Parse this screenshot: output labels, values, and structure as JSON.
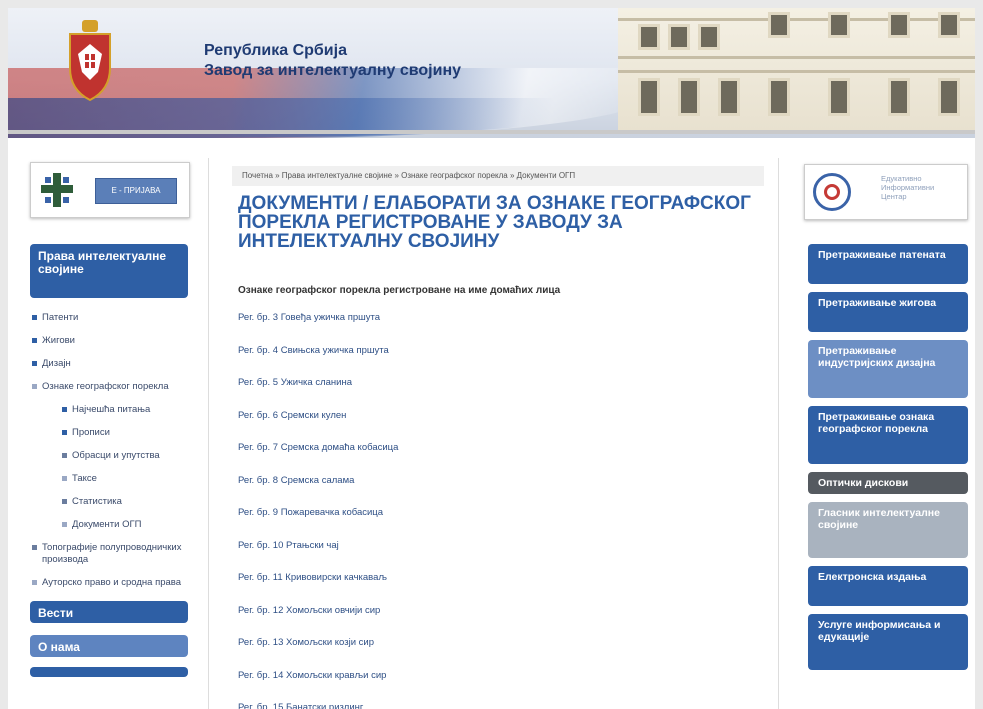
{
  "header": {
    "line1": "Република Србија",
    "line2": "Завод за интелектуалну својину"
  },
  "eprijava": {
    "button_label": "Е - ПРИЈАВА"
  },
  "left_nav": {
    "section_title": "Права интелектуалне својине",
    "items": [
      {
        "label": "Патенти",
        "level": 1
      },
      {
        "label": "Жигови",
        "level": 1
      },
      {
        "label": "Дизајн",
        "level": 1
      },
      {
        "label": "Ознаке географског порекла",
        "level": 1
      },
      {
        "label": "Најчешћа питања",
        "level": 2
      },
      {
        "label": "Прописи",
        "level": 2
      },
      {
        "label": "Обрасци и упутства",
        "level": 2
      },
      {
        "label": "Таксе",
        "level": 2
      },
      {
        "label": "Статистика",
        "level": 2
      },
      {
        "label": "Документи ОГП",
        "level": 2
      },
      {
        "label": "Топографије полупроводничких производа",
        "level": 1
      },
      {
        "label": "Ауторско право и сродна права",
        "level": 1
      }
    ],
    "bottom_buttons": [
      "Вести",
      "О нама"
    ]
  },
  "breadcrumb": "Почетна » Права интелектуалне својине » Ознаке географског порекла » Документи ОГП",
  "main": {
    "title": "ДОКУМЕНТИ / ЕЛАБОРАТИ ЗА ОЗНАКЕ ГЕОГРАФСКОГ ПОРЕКЛА РЕГИСТРОВАНЕ У ЗАВОДУ ЗА ИНТЕЛЕКТУАЛНУ СВОЈИНУ",
    "subtitle": "Ознаке географског порекла регистроване на име домаћих лица",
    "registrations": [
      "Рег. бр. 3 Говеђа ужичка пршута",
      "Рег. бр. 4 Свињска ужичка пршута",
      "Рег. бр. 5 Ужичка сланина",
      "Рег. бр. 6 Сремски кулен",
      "Рег. бр. 7 Сремска домаћа кобасица",
      "Рег. бр. 8 Сремска салама",
      "Рег. бр. 9 Пожаревачка кобасица",
      "Рег. бр. 10 Ртањски чај",
      "Рег. бр. 11 Кривовирски качкаваљ",
      "Рег. бр. 12 Хомољски овчији сир",
      "Рег. бр. 13 Хомољски козји сир",
      "Рег. бр. 14 Хомољски крављи сир",
      "Рег. бр. 15 Банатски ризлинг"
    ]
  },
  "edic": {
    "line1": "Едукативно",
    "line2": "Информативни",
    "line3": "Центар"
  },
  "right_nav": [
    {
      "label": "Претраживање патената",
      "color": "#2e5fa5"
    },
    {
      "label": "Претраживање жигова",
      "color": "#2e5fa5"
    },
    {
      "label": "Претраживање индустријских дизајна",
      "color": "#6d8fc4"
    },
    {
      "label": "Претраживање ознака географског порекла",
      "color": "#2e5fa5"
    },
    {
      "label": "Оптички дискови",
      "color": "#555a60"
    },
    {
      "label": "Гласник интелектуалне својине",
      "color": "#a9b3bf"
    },
    {
      "label": "Електронска издања",
      "color": "#2e5fa5"
    },
    {
      "label": "Услуге информисања и едукације",
      "color": "#2e5fa5"
    }
  ]
}
